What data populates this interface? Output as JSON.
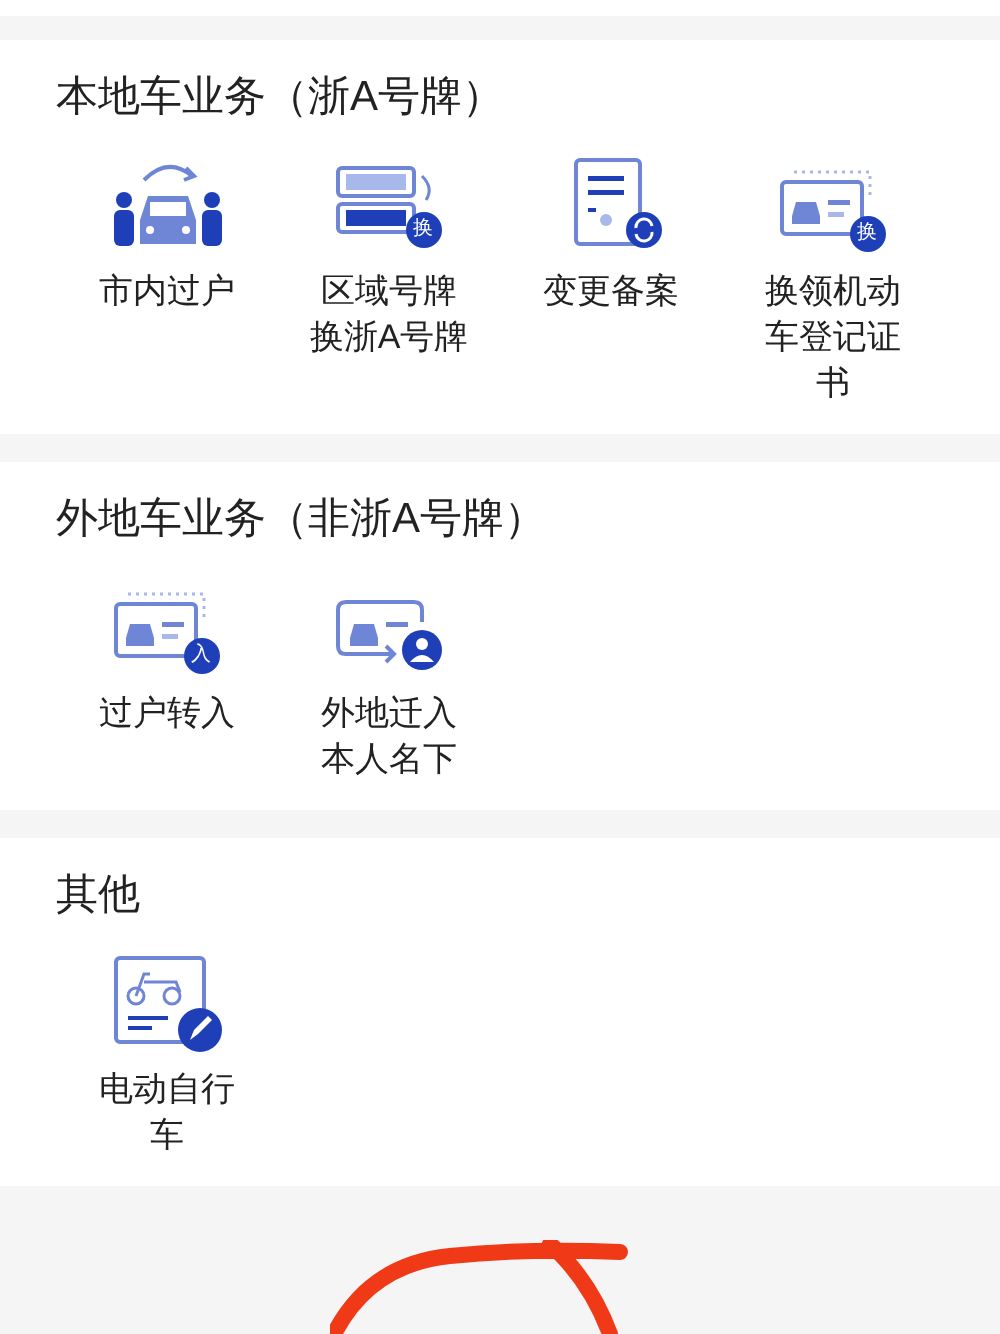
{
  "sections": [
    {
      "title": "本地车业务（浙A号牌）",
      "items": [
        {
          "kind": "transfer",
          "lines": [
            "市内过户"
          ]
        },
        {
          "kind": "plate",
          "badge": "换",
          "lines": [
            "区域号牌",
            "换浙A号牌"
          ]
        },
        {
          "kind": "record",
          "lines": [
            "变更备案"
          ]
        },
        {
          "kind": "card",
          "badge": "换",
          "lines": [
            "换领机动",
            "车登记证",
            "书"
          ]
        }
      ]
    },
    {
      "title": "外地车业务（非浙A号牌）",
      "items": [
        {
          "kind": "card",
          "badge": "入",
          "lines": [
            "过户转入"
          ]
        },
        {
          "kind": "person",
          "lines": [
            "外地迁入",
            "本人名下"
          ]
        }
      ]
    },
    {
      "title": "其他",
      "items": [
        {
          "kind": "ebike",
          "lines": [
            "电动自行",
            "车"
          ]
        }
      ]
    }
  ]
}
